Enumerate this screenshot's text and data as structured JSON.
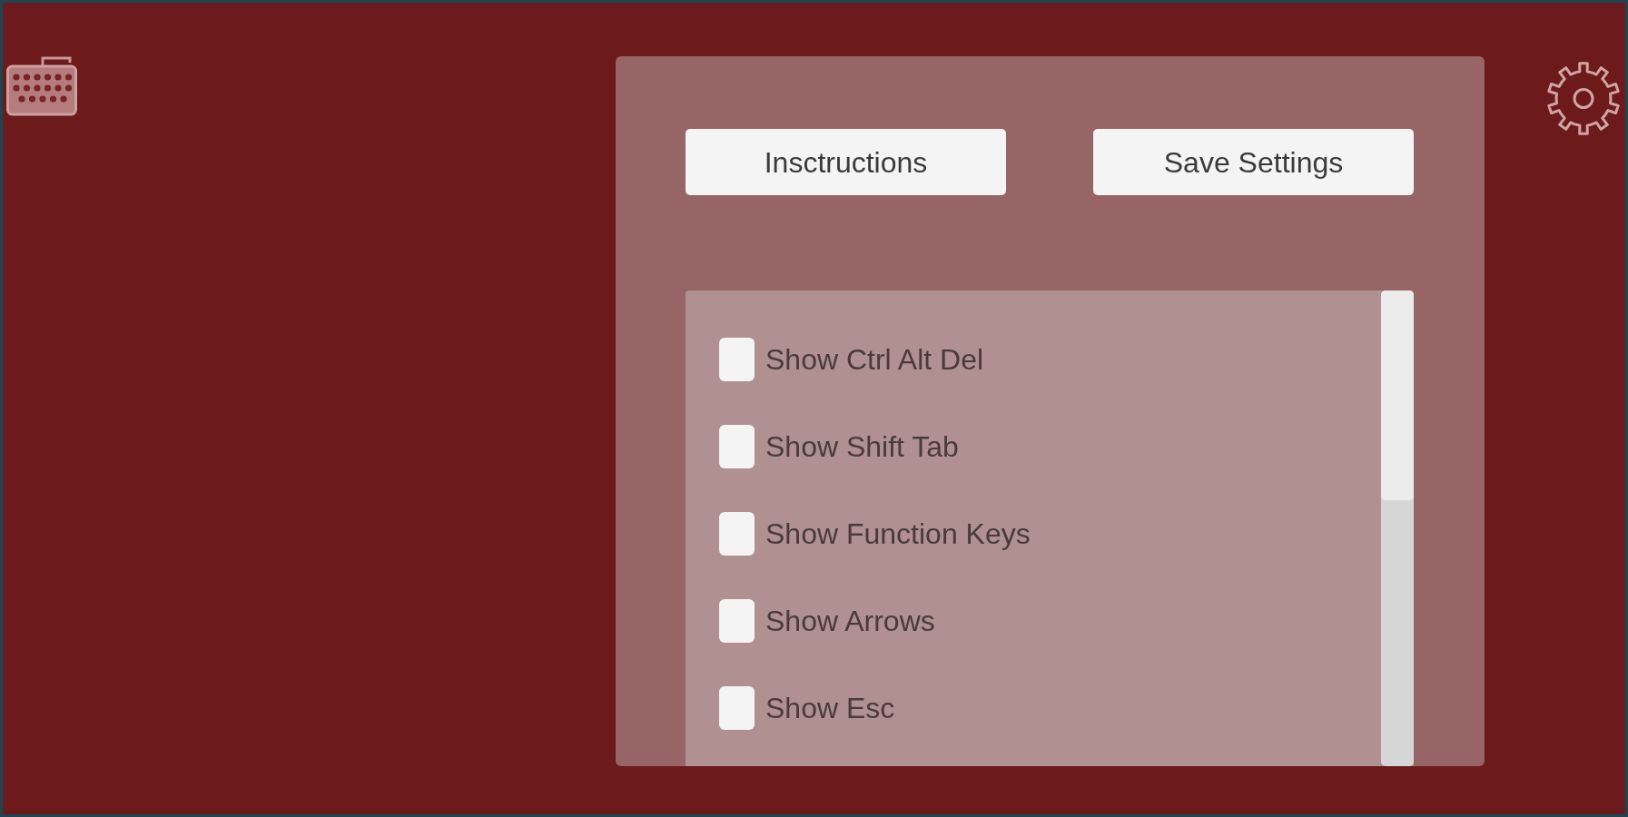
{
  "buttons": [
    {
      "label": "Insctructions"
    },
    {
      "label": "Save Settings"
    }
  ],
  "options": [
    {
      "label": "Show Ctrl Alt Del",
      "checked": false
    },
    {
      "label": "Show Shift Tab",
      "checked": false
    },
    {
      "label": "Show Function Keys",
      "checked": false
    },
    {
      "label": "Show Arrows",
      "checked": false
    },
    {
      "label": "Show Esc",
      "checked": false
    }
  ]
}
